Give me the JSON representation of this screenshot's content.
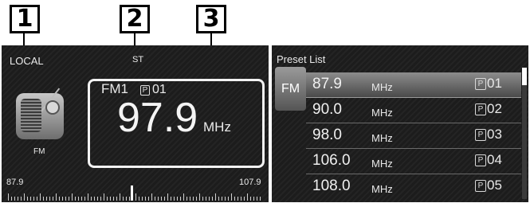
{
  "callouts": [
    "1",
    "2",
    "3"
  ],
  "left_screen": {
    "local_label": "LOCAL",
    "stereo_label": "ST",
    "source_label": "FM",
    "band_label": "FM1",
    "preset_badge": "P",
    "preset_num": "01",
    "frequency": "97.9",
    "unit": "MHz",
    "tuner_min": "87.9",
    "tuner_max": "107.9"
  },
  "preset_list": {
    "title": "Preset List",
    "band_button": "FM",
    "items": [
      {
        "freq": "87.9",
        "unit": "MHz",
        "badge": "P",
        "num": "01",
        "selected": true
      },
      {
        "freq": "90.0",
        "unit": "MHz",
        "badge": "P",
        "num": "02",
        "selected": false
      },
      {
        "freq": "98.0",
        "unit": "MHz",
        "badge": "P",
        "num": "03",
        "selected": false
      },
      {
        "freq": "106.0",
        "unit": "MHz",
        "badge": "P",
        "num": "04",
        "selected": false
      },
      {
        "freq": "108.0",
        "unit": "MHz",
        "badge": "P",
        "num": "05",
        "selected": false
      }
    ]
  },
  "icons": [
    "radio-icon",
    "preset-p-icon"
  ],
  "colors": {
    "screen_bg": "#1c1c1c",
    "text": "#eaeaea",
    "selected_row": "#8c8c8c"
  }
}
